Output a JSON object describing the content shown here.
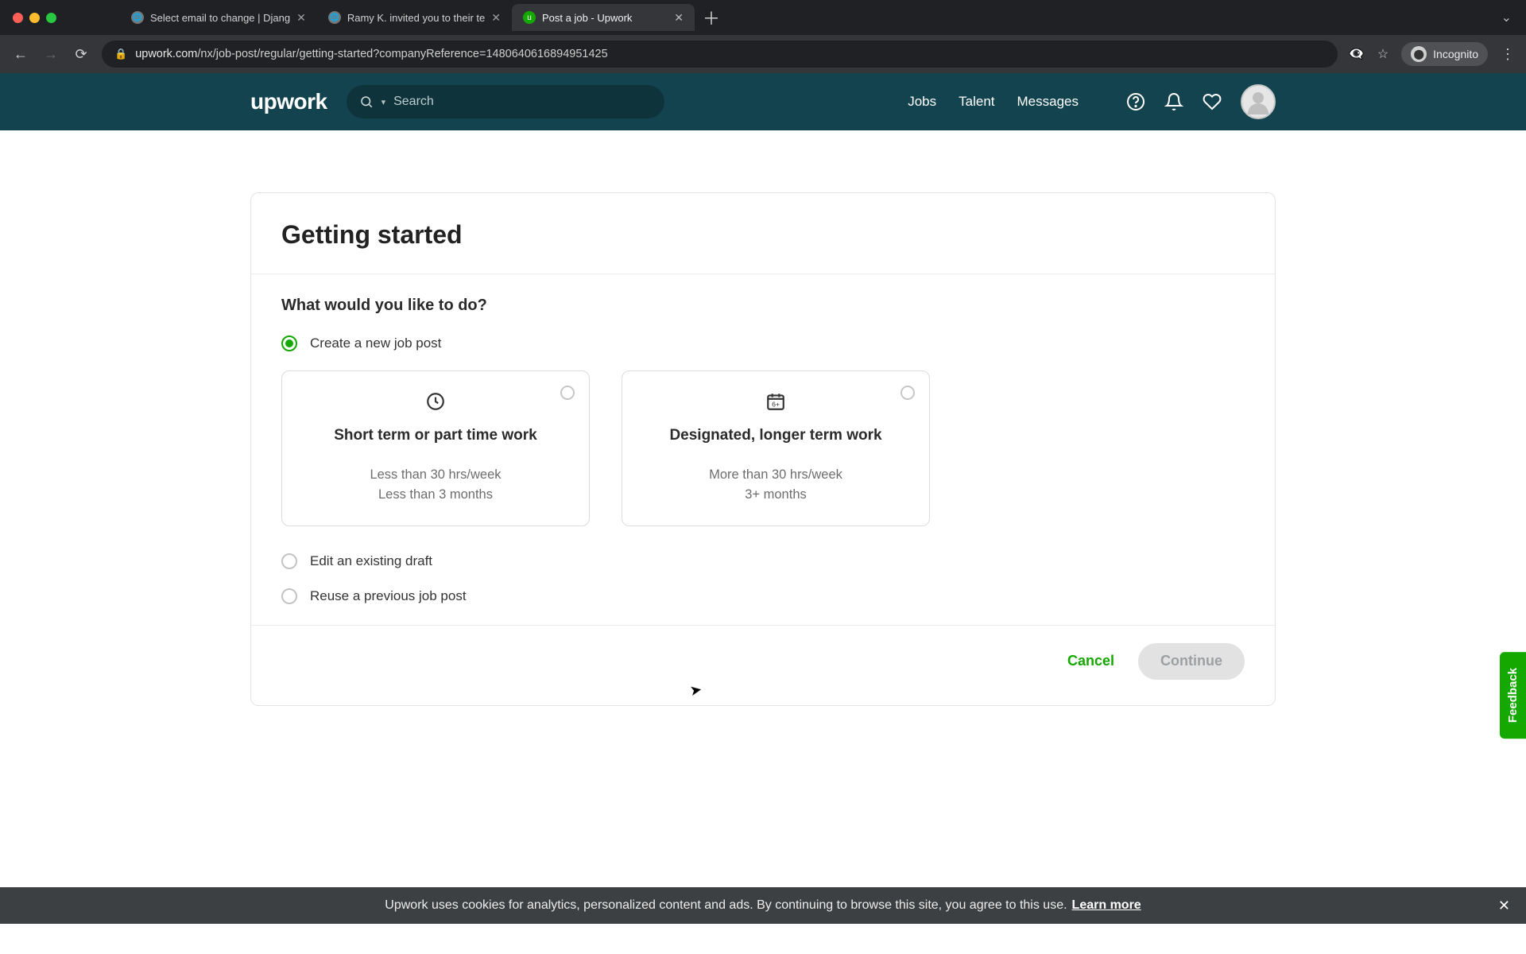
{
  "browser": {
    "tabs": [
      {
        "title": "Select email to change | Djang",
        "active": false
      },
      {
        "title": "Ramy K. invited you to their te",
        "active": false
      },
      {
        "title": "Post a job - Upwork",
        "active": true
      }
    ],
    "url_domain": "upwork.com",
    "url_path": "/nx/job-post/regular/getting-started?companyReference=1480640616894951425",
    "incognito_label": "Incognito"
  },
  "header": {
    "logo_text": "upwork",
    "search_placeholder": "Search",
    "nav": {
      "jobs": "Jobs",
      "talent": "Talent",
      "messages": "Messages"
    }
  },
  "page": {
    "title": "Getting started",
    "prompt": "What would you like to do?",
    "options": {
      "create": {
        "label": "Create a new job post",
        "selected": true
      },
      "edit": {
        "label": "Edit an existing draft",
        "selected": false
      },
      "reuse": {
        "label": "Reuse a previous job post",
        "selected": false
      }
    },
    "term_cards": [
      {
        "id": "short-term",
        "title": "Short term or part time work",
        "line1": "Less than 30 hrs/week",
        "line2": "Less than 3 months",
        "selected": false
      },
      {
        "id": "long-term",
        "title": "Designated, longer term work",
        "line1": "More than 30 hrs/week",
        "line2": "3+ months",
        "selected": false
      }
    ],
    "footer": {
      "cancel": "Cancel",
      "continue": "Continue"
    }
  },
  "feedback_label": "Feedback",
  "cookie": {
    "text": "Upwork uses cookies for analytics, personalized content and ads. By continuing to browse this site, you agree to this use. ",
    "link": "Learn more"
  }
}
